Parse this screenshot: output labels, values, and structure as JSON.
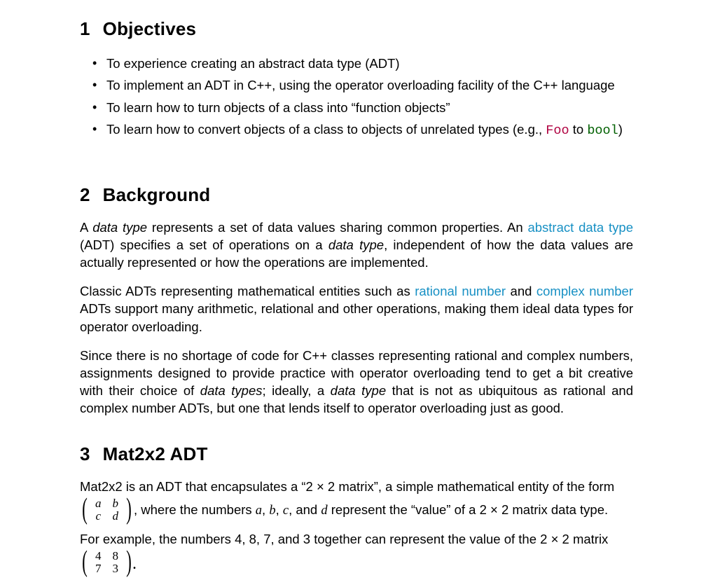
{
  "sections": {
    "s1": {
      "num": "1",
      "title": "Objectives"
    },
    "s2": {
      "num": "2",
      "title": "Background"
    },
    "s3": {
      "num": "3",
      "title": "Mat2x2 ADT"
    }
  },
  "objectives": {
    "b1": "To experience creating an abstract data type (ADT)",
    "b2": "To implement an ADT in C++, using the operator overloading facility of the C++ language",
    "b3": "To learn how to turn objects of a class into “function objects”",
    "b4_a": "To learn how to convert objects of a class to objects of unrelated types (e.g., ",
    "b4_foo": "Foo",
    "b4_to": " to ",
    "b4_bool": "bool",
    "b4_z": ")"
  },
  "bg": {
    "p1_a": "A ",
    "p1_dt": "data type",
    "p1_b": " represents a set of data values sharing common properties. An ",
    "p1_link": "abstract data type",
    "p1_c": " (ADT) specifies a set of operations on a ",
    "p1_dt2": "data type",
    "p1_d": ", independent of how the data values are actually represented or how the operations are implemented.",
    "p2_a": "Classic ADTs representing mathematical entities such as ",
    "p2_link1": "rational number",
    "p2_b": " and ",
    "p2_link2": "complex number",
    "p2_c": " ADTs support many arithmetic, relational and other operations, making them ideal data types for operator overloading.",
    "p3_a": "Since there is no shortage of code for C++ classes representing rational and complex numbers, assignments designed to provide practice with operator overloading tend to get a bit creative with their choice of ",
    "p3_dt": "data types",
    "p3_b": "; ideally, a ",
    "p3_dt2": "data type",
    "p3_c": " that is not as ubiquitous as rational and complex number ADTs, but one that lends itself to operator overloading just as good."
  },
  "mat": {
    "p1_a": "Mat2x2 is an ADT that encapsulates a “2 × 2 matrix”, a simple mathematical entity of the form",
    "sym": {
      "a": "a",
      "b": "b",
      "c": "c",
      "d": "d"
    },
    "p1_after_a": ", where the numbers ",
    "va": "a",
    "vb": "b",
    "vc": "c",
    "vd": "d",
    "p1_after_b": " represent the “value” of a 2 × 2 matrix data type.",
    "comma1": ", ",
    "comma2": ", ",
    "and": ", and ",
    "p2_a": "For example, the numbers 4, 8, 7, and 3 together can represent the value of the 2 × 2 matrix",
    "ex": {
      "a": "4",
      "b": "8",
      "c": "7",
      "d": "3"
    },
    "dot": "."
  }
}
